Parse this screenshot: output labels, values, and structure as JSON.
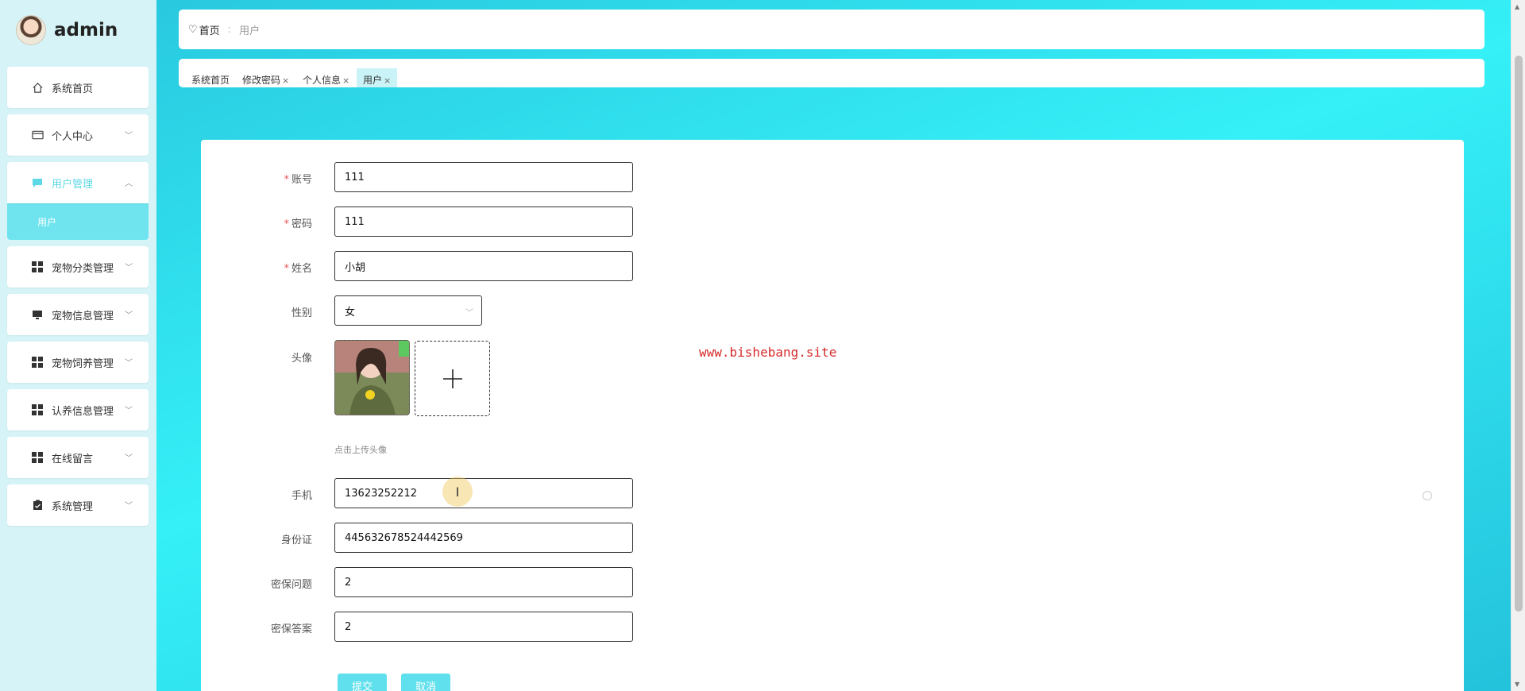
{
  "brand": {
    "name": "admin"
  },
  "sidebar": {
    "items": [
      {
        "label": "系统首页",
        "icon": "home-icon"
      },
      {
        "label": "个人中心",
        "icon": "wallet-icon"
      },
      {
        "label": "用户管理",
        "icon": "chat-icon",
        "sub": [
          "用户"
        ]
      },
      {
        "label": "宠物分类管理",
        "icon": "grid-icon"
      },
      {
        "label": "宠物信息管理",
        "icon": "monitor-icon"
      },
      {
        "label": "宠物饲养管理",
        "icon": "grid-icon"
      },
      {
        "label": "认养信息管理",
        "icon": "grid-icon"
      },
      {
        "label": "在线留言",
        "icon": "grid-icon"
      },
      {
        "label": "系统管理",
        "icon": "clipboard-icon"
      }
    ]
  },
  "breadcrumb": {
    "home": "首页",
    "separator": ":",
    "current": "用户"
  },
  "tabs": [
    {
      "label": "系统首页"
    },
    {
      "label": "修改密码"
    },
    {
      "label": "个人信息"
    },
    {
      "label": "用户"
    }
  ],
  "form": {
    "account": {
      "label": "账号",
      "value": "111"
    },
    "password": {
      "label": "密码",
      "value": "111"
    },
    "name": {
      "label": "姓名",
      "value": "小胡"
    },
    "gender": {
      "label": "性别",
      "value": "女"
    },
    "avatar": {
      "label": "头像",
      "hint": "点击上传头像"
    },
    "phone": {
      "label": "手机",
      "value": "13623252212"
    },
    "id_card": {
      "label": "身份证",
      "value": "445632678524442569"
    },
    "security_question": {
      "label": "密保问题",
      "value": "2"
    },
    "security_answer": {
      "label": "密保答案",
      "value": "2"
    },
    "required_mark": "*",
    "submit_label": "提交",
    "cancel_label": "取消"
  },
  "watermark": "www.bishebang.site",
  "colors": {
    "accent": "#5fe0ec",
    "main_bg": "#35f0f7",
    "sidebar_bg": "#d6f4f8",
    "watermark": "#d62a2a"
  }
}
